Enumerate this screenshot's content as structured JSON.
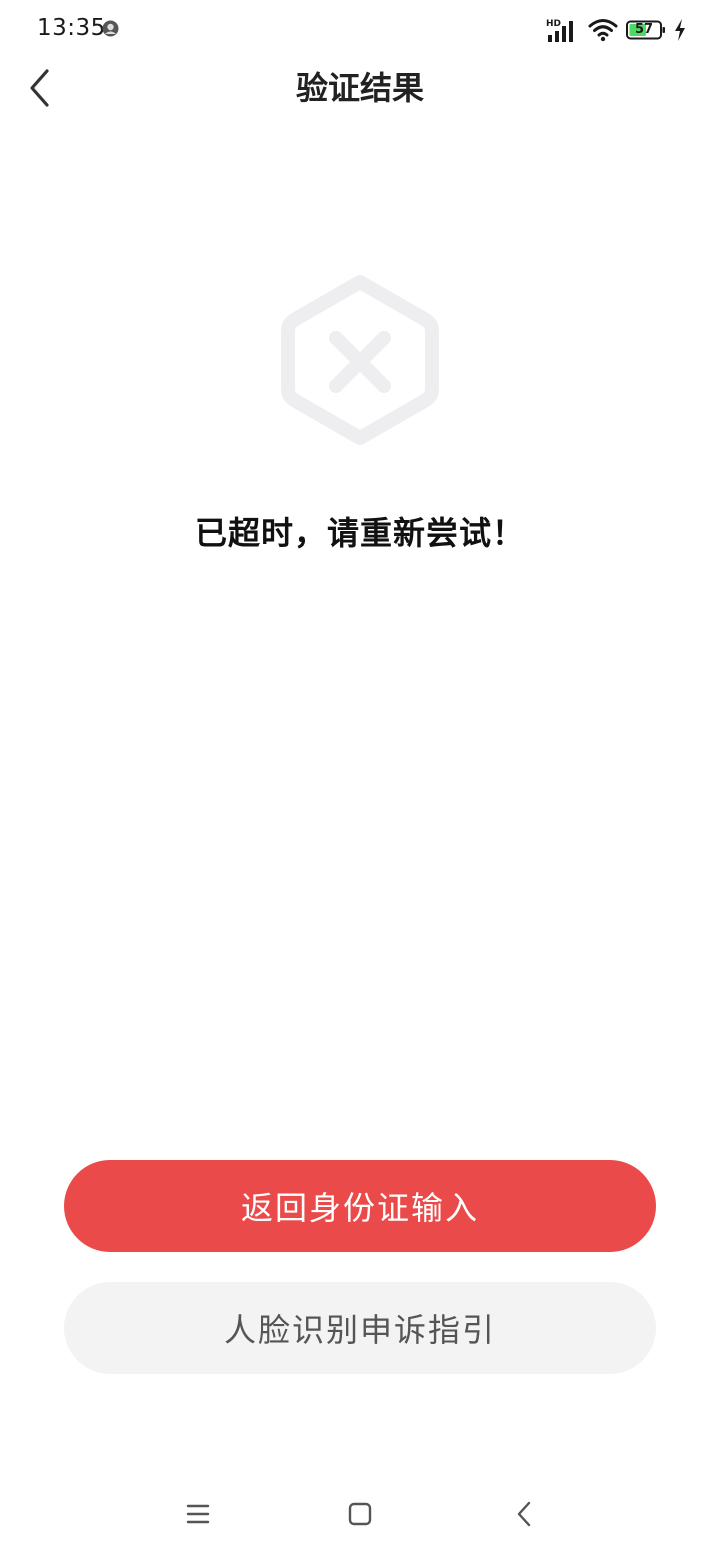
{
  "status_bar": {
    "time": "13:35",
    "network_label": "HD",
    "battery_level": "57",
    "charging": true,
    "battery_fill_color": "#4cd964"
  },
  "header": {
    "title": "验证结果",
    "back_icon": "chevron-left-icon"
  },
  "result": {
    "icon": "hexagon-close-icon",
    "icon_color": "#eeeef1",
    "message": "已超时，请重新尝试！"
  },
  "actions": {
    "primary_label": "返回身份证输入",
    "primary_color": "#eb4a4a",
    "secondary_label": "人脸识别申诉指引",
    "secondary_color": "#f3f3f3"
  },
  "system_nav": {
    "menu_icon": "menu-icon",
    "home_icon": "home-square-icon",
    "back_icon": "back-triangle-icon"
  }
}
